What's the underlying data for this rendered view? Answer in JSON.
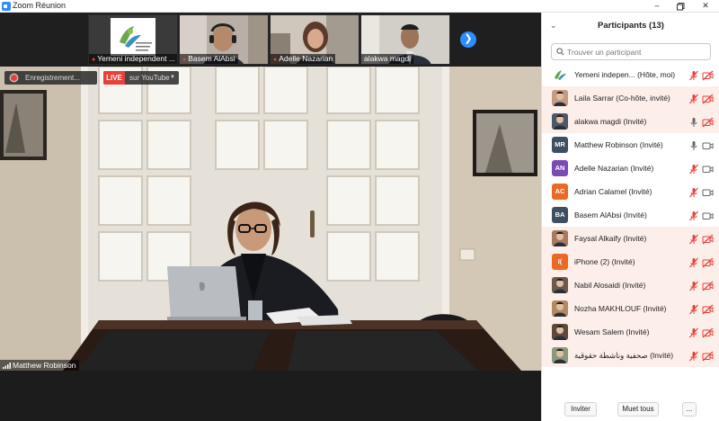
{
  "window": {
    "title": "Zoom Réunion"
  },
  "thumbnails": [
    {
      "name": "Yemeni independent ...",
      "muted": true
    },
    {
      "name": "Basem AlAbsi",
      "muted": true
    },
    {
      "name": "Adelle Nazarian",
      "muted": true
    },
    {
      "name": "alakwa magdi",
      "muted": false
    }
  ],
  "main": {
    "recording_label": "Enregistrement...",
    "live_tag": "LIVE",
    "live_label": "sur YouTube",
    "speaker": "Matthew Robinson"
  },
  "panel": {
    "title": "Participants (13)",
    "search_placeholder": "Trouver un participant",
    "participants": [
      {
        "name": "Yemeni indepen... (Hôte, moi)",
        "avatar": "",
        "avatar_color": "#e9f2e6",
        "mic": "muted",
        "cam": "off",
        "highlight": false,
        "photo": "logo"
      },
      {
        "name": "Laila Sarrar (Co-hôte, invité)",
        "avatar": "",
        "avatar_color": "#c79a84",
        "mic": "muted",
        "cam": "off",
        "highlight": true,
        "photo": "face"
      },
      {
        "name": "alakwa magdi (Invité)",
        "avatar": "",
        "avatar_color": "#4b5a68",
        "mic": "on",
        "cam": "off",
        "highlight": true,
        "photo": "face"
      },
      {
        "name": "Matthew Robinson (Invité)",
        "avatar": "MR",
        "avatar_color": "#3e4e63",
        "mic": "on",
        "cam": "on",
        "highlight": false,
        "photo": ""
      },
      {
        "name": "Adelle Nazarian (Invité)",
        "avatar": "AN",
        "avatar_color": "#7b4bb3",
        "mic": "muted",
        "cam": "on",
        "highlight": false,
        "photo": ""
      },
      {
        "name": "Adrian Calamel (Invité)",
        "avatar": "AC",
        "avatar_color": "#e86a24",
        "mic": "muted",
        "cam": "on",
        "highlight": false,
        "photo": ""
      },
      {
        "name": "Basem AlAbsi (Invité)",
        "avatar": "BA",
        "avatar_color": "#3e4e63",
        "mic": "muted",
        "cam": "on",
        "highlight": false,
        "photo": ""
      },
      {
        "name": "Faysal Alkaify (Invité)",
        "avatar": "",
        "avatar_color": "#a67b5f",
        "mic": "muted",
        "cam": "off",
        "highlight": true,
        "photo": "face"
      },
      {
        "name": "iPhone (2) (Invité)",
        "avatar": "I(",
        "avatar_color": "#e86a24",
        "mic": "muted",
        "cam": "off",
        "highlight": true,
        "photo": ""
      },
      {
        "name": "Nabil Alosaidi (Invité)",
        "avatar": "",
        "avatar_color": "#6c5a4c",
        "mic": "muted",
        "cam": "off",
        "highlight": true,
        "photo": "face"
      },
      {
        "name": "Nozha MAKHLOUF (Invité)",
        "avatar": "",
        "avatar_color": "#b38964",
        "mic": "muted",
        "cam": "off",
        "highlight": true,
        "photo": "face"
      },
      {
        "name": "Wesam Salem (Invité)",
        "avatar": "",
        "avatar_color": "#5e4a3c",
        "mic": "muted",
        "cam": "off",
        "highlight": true,
        "photo": "face"
      },
      {
        "name": "صحفية وناشطة حقوقية (Invité)",
        "avatar": "",
        "avatar_color": "#8a9a78",
        "mic": "muted",
        "cam": "off",
        "highlight": true,
        "photo": "face"
      }
    ],
    "footer": {
      "invite": "Inviter",
      "mute_all": "Muet tous",
      "more": "..."
    }
  },
  "colors": {
    "accent": "#2d8cff",
    "muted_red": "#e8403a",
    "row_highlight": "#fcefe9",
    "live": "#e8403a"
  },
  "icons": [
    "zoom-app-icon",
    "minimize-icon",
    "maximize-icon",
    "close-icon",
    "chevron-right-icon",
    "chevron-down-icon",
    "search-icon",
    "mic-icon",
    "mic-muted-icon",
    "camera-icon",
    "camera-off-icon",
    "signal-bars-icon"
  ]
}
